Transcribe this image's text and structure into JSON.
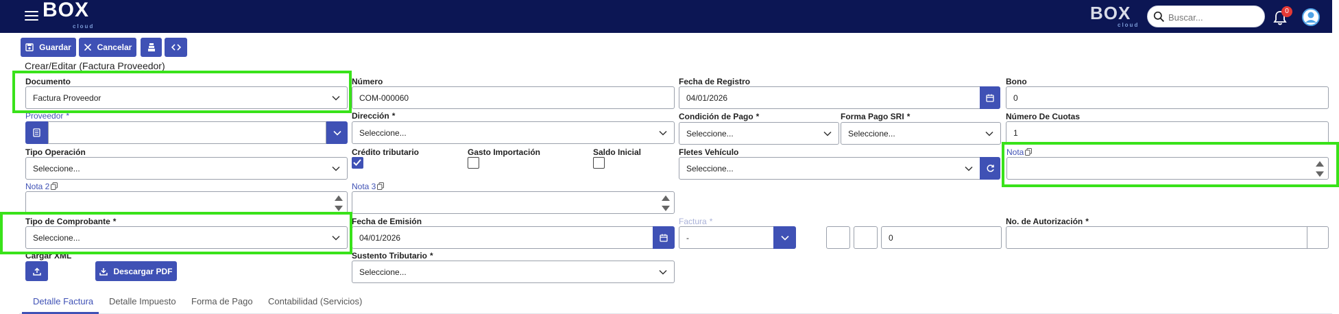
{
  "header": {
    "logo_text": "BOX",
    "logo_sub": "cloud",
    "search_placeholder": "Buscar...",
    "notifications_count": "0"
  },
  "toolbar": {
    "save_label": "Guardar",
    "cancel_label": "Cancelar"
  },
  "page_title": "Crear/Editar (Factura Proveedor)",
  "form": {
    "documento": {
      "label": "Documento",
      "value": "Factura Proveedor"
    },
    "numero": {
      "label": "Número",
      "value": "COM-000060"
    },
    "fecha_registro": {
      "label": "Fecha de Registro",
      "value": "04/01/2026"
    },
    "bono": {
      "label": "Bono",
      "value": "0"
    },
    "proveedor": {
      "label": "Proveedor",
      "required": "*",
      "value": ""
    },
    "direccion": {
      "label": "Dirección",
      "required": "*",
      "value": "Seleccione..."
    },
    "condicion_pago": {
      "label": "Condición de Pago",
      "required": "*",
      "value": "Seleccione..."
    },
    "forma_pago_sri": {
      "label": "Forma Pago SRI",
      "required": "*",
      "value": "Seleccione..."
    },
    "numero_cuotas": {
      "label": "Número De Cuotas",
      "value": "1"
    },
    "tipo_operacion": {
      "label": "Tipo Operación",
      "value": "Seleccione..."
    },
    "credito_tributario": {
      "label": "Crédito tributario",
      "checked": true
    },
    "gasto_importacion": {
      "label": "Gasto Importación",
      "checked": false
    },
    "saldo_inicial": {
      "label": "Saldo Inicial",
      "checked": false
    },
    "fletes_vehiculo": {
      "label": "Fletes Vehículo",
      "value": "Seleccione..."
    },
    "nota": {
      "label": "Nota",
      "value": ""
    },
    "nota2": {
      "label": "Nota 2",
      "value": ""
    },
    "nota3": {
      "label": "Nota 3",
      "value": ""
    },
    "tipo_comprobante": {
      "label": "Tipo de Comprobante",
      "required": "*",
      "value": "Seleccione..."
    },
    "fecha_emision": {
      "label": "Fecha de Emisión",
      "value": "04/01/2026"
    },
    "factura": {
      "label": "Factura",
      "required": "*",
      "value": "-",
      "seq_value": "0"
    },
    "no_autorizacion": {
      "label": "No. de Autorización",
      "required": "*",
      "value": ""
    },
    "cargar_xml": {
      "label": "Cargar XML"
    },
    "descargar_pdf": {
      "label": "Descargar PDF"
    },
    "sustento_tributario": {
      "label": "Sustento Tributario",
      "required": "*",
      "value": "Seleccione..."
    }
  },
  "tabs": [
    {
      "label": "Detalle Factura",
      "active": true
    },
    {
      "label": "Detalle Impuesto",
      "active": false
    },
    {
      "label": "Forma de Pago",
      "active": false
    },
    {
      "label": "Contabilidad (Servicios)",
      "active": false
    }
  ],
  "colors": {
    "header_bg": "#0c1654",
    "primary": "#3f51b5",
    "highlight": "#39e21a",
    "badge": "#e53935"
  }
}
